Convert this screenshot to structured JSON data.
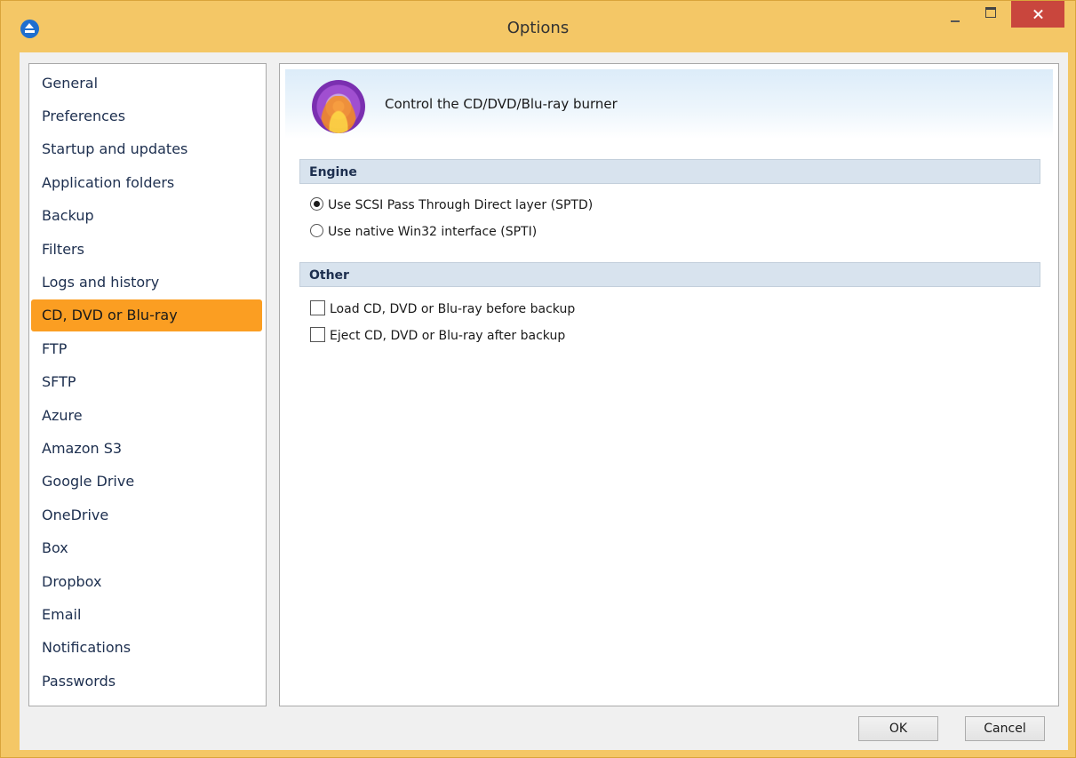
{
  "window": {
    "title": "Options"
  },
  "sidebar": {
    "items": [
      {
        "label": "General"
      },
      {
        "label": "Preferences"
      },
      {
        "label": "Startup and updates"
      },
      {
        "label": "Application folders"
      },
      {
        "label": "Backup"
      },
      {
        "label": "Filters"
      },
      {
        "label": "Logs and history"
      },
      {
        "label": "CD, DVD or Blu-ray",
        "selected": true
      },
      {
        "label": "FTP"
      },
      {
        "label": "SFTP"
      },
      {
        "label": "Azure"
      },
      {
        "label": "Amazon S3"
      },
      {
        "label": "Google Drive"
      },
      {
        "label": "OneDrive"
      },
      {
        "label": "Box"
      },
      {
        "label": "Dropbox"
      },
      {
        "label": "Email"
      },
      {
        "label": "Notifications"
      },
      {
        "label": "Passwords"
      }
    ]
  },
  "panel": {
    "banner_icon": "cd-dvd-burner-icon",
    "banner_text": "Control the CD/DVD/Blu-ray burner",
    "engine": {
      "header": "Engine",
      "options": [
        {
          "label": "Use SCSI Pass Through Direct layer (SPTD)",
          "checked": true
        },
        {
          "label": "Use native Win32 interface (SPTI)",
          "checked": false
        }
      ]
    },
    "other": {
      "header": "Other",
      "options": [
        {
          "label": "Load CD, DVD or Blu-ray before backup",
          "checked": false
        },
        {
          "label": "Eject CD, DVD or Blu-ray after backup",
          "checked": false
        }
      ]
    }
  },
  "buttons": {
    "ok": "OK",
    "cancel": "Cancel"
  },
  "colors": {
    "titlebar": "#f4c766",
    "selected_item": "#fb9e22",
    "close_button": "#c9463d",
    "section_header": "#d8e3ee"
  }
}
